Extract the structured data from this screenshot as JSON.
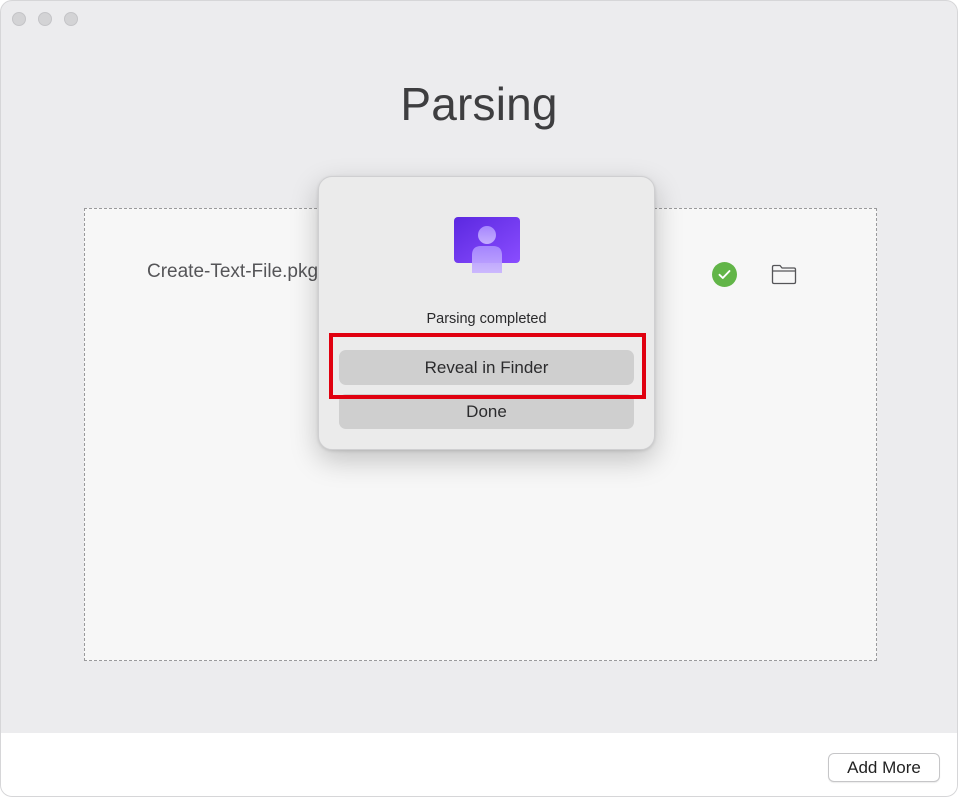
{
  "window": {
    "title": "Parsing"
  },
  "file_list": {
    "items": [
      {
        "filename": "Create-Text-File.pkg",
        "status_icon": "check-circle-icon",
        "action_icon": "folder-icon"
      }
    ]
  },
  "dialog": {
    "icon": "app-person-icon",
    "message": "Parsing completed",
    "reveal_label": "Reveal in Finder",
    "done_label": "Done"
  },
  "footer": {
    "add_more_label": "Add More"
  },
  "colors": {
    "highlight": "#e0000f",
    "success": "#62b548",
    "icon_gradient_start": "#5b28e0",
    "icon_gradient_end": "#8a4dff"
  }
}
